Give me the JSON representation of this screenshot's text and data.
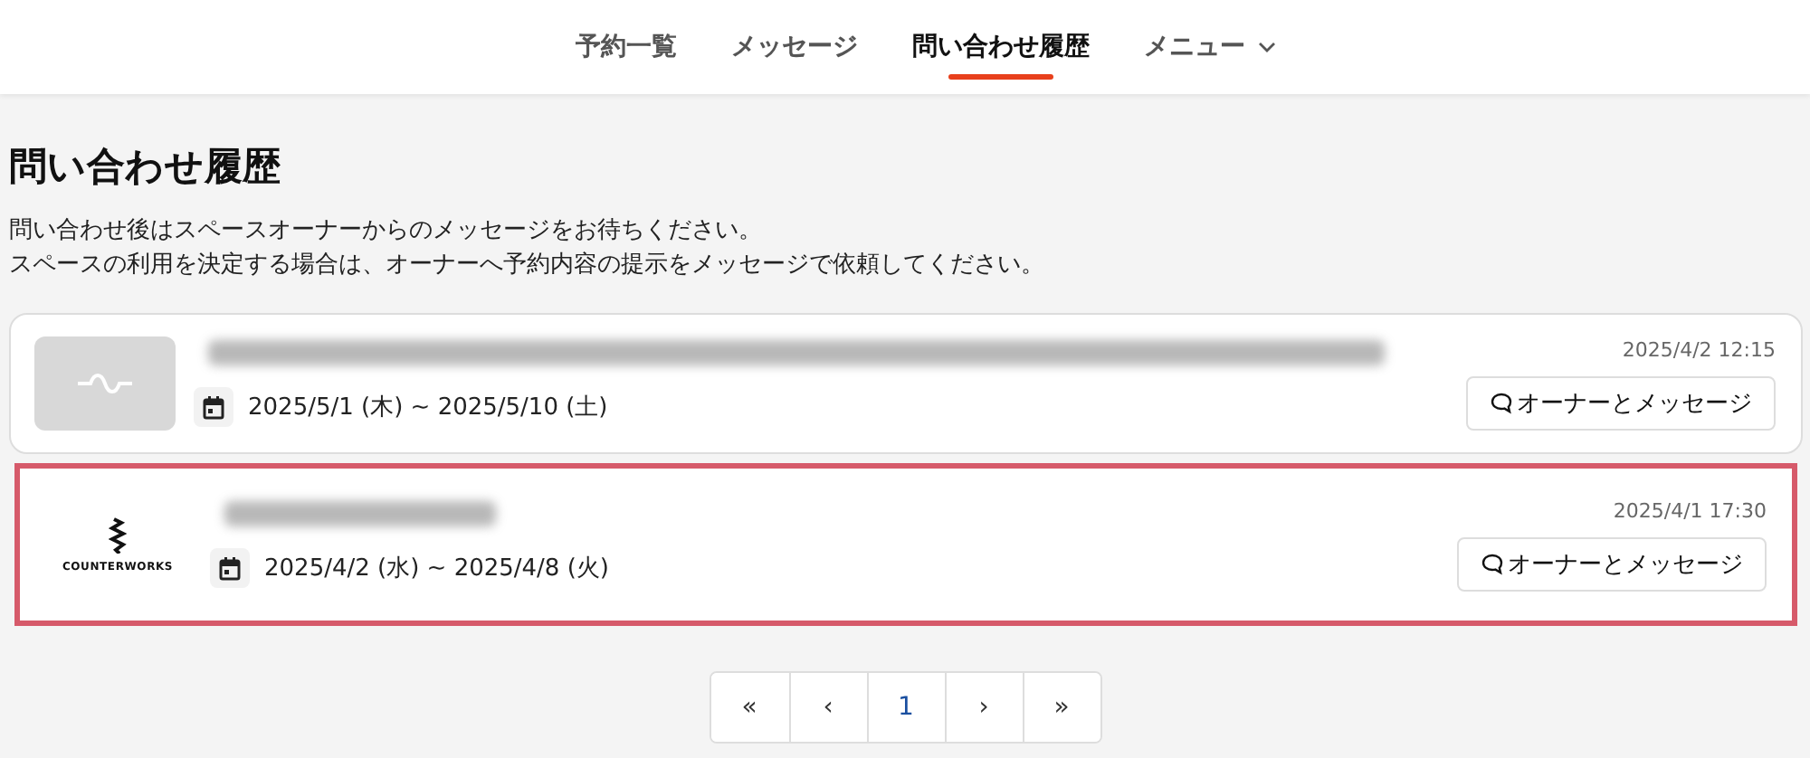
{
  "nav": {
    "items": [
      {
        "label": "予約一覧",
        "selected": false,
        "kind": "link"
      },
      {
        "label": "メッセージ",
        "selected": false,
        "kind": "link"
      },
      {
        "label": "問い合わせ履歴",
        "selected": true,
        "kind": "link"
      },
      {
        "label": "メニュー",
        "selected": false,
        "kind": "dropdown"
      }
    ]
  },
  "page": {
    "title": "問い合わせ履歴",
    "description": [
      "問い合わせ後はスペースオーナーからのメッセージをお待ちください。",
      "スペースの利用を決定する場合は、オーナーへ予約内容の提示をメッセージで依頼してください。"
    ]
  },
  "inquiries": [
    {
      "thumbnail": {
        "kind": "placeholder"
      },
      "title_redacted": true,
      "dates": "2025/5/1 (木) ~ 2025/5/10 (土)",
      "timestamp": "2025/4/2 12:15",
      "button": "オーナーとメッセージ",
      "highlighted": false
    },
    {
      "thumbnail": {
        "kind": "logo",
        "text": "COUNTERWORKS"
      },
      "title_redacted": true,
      "dates": "2025/4/2 (水) ~ 2025/4/8 (火)",
      "timestamp": "2025/4/1 17:30",
      "button": "オーナーとメッセージ",
      "highlighted": true
    }
  ],
  "pagination": {
    "first": "«",
    "prev": "‹",
    "pages": [
      {
        "label": "1",
        "selected": true
      }
    ],
    "next": "›",
    "last": "»"
  }
}
